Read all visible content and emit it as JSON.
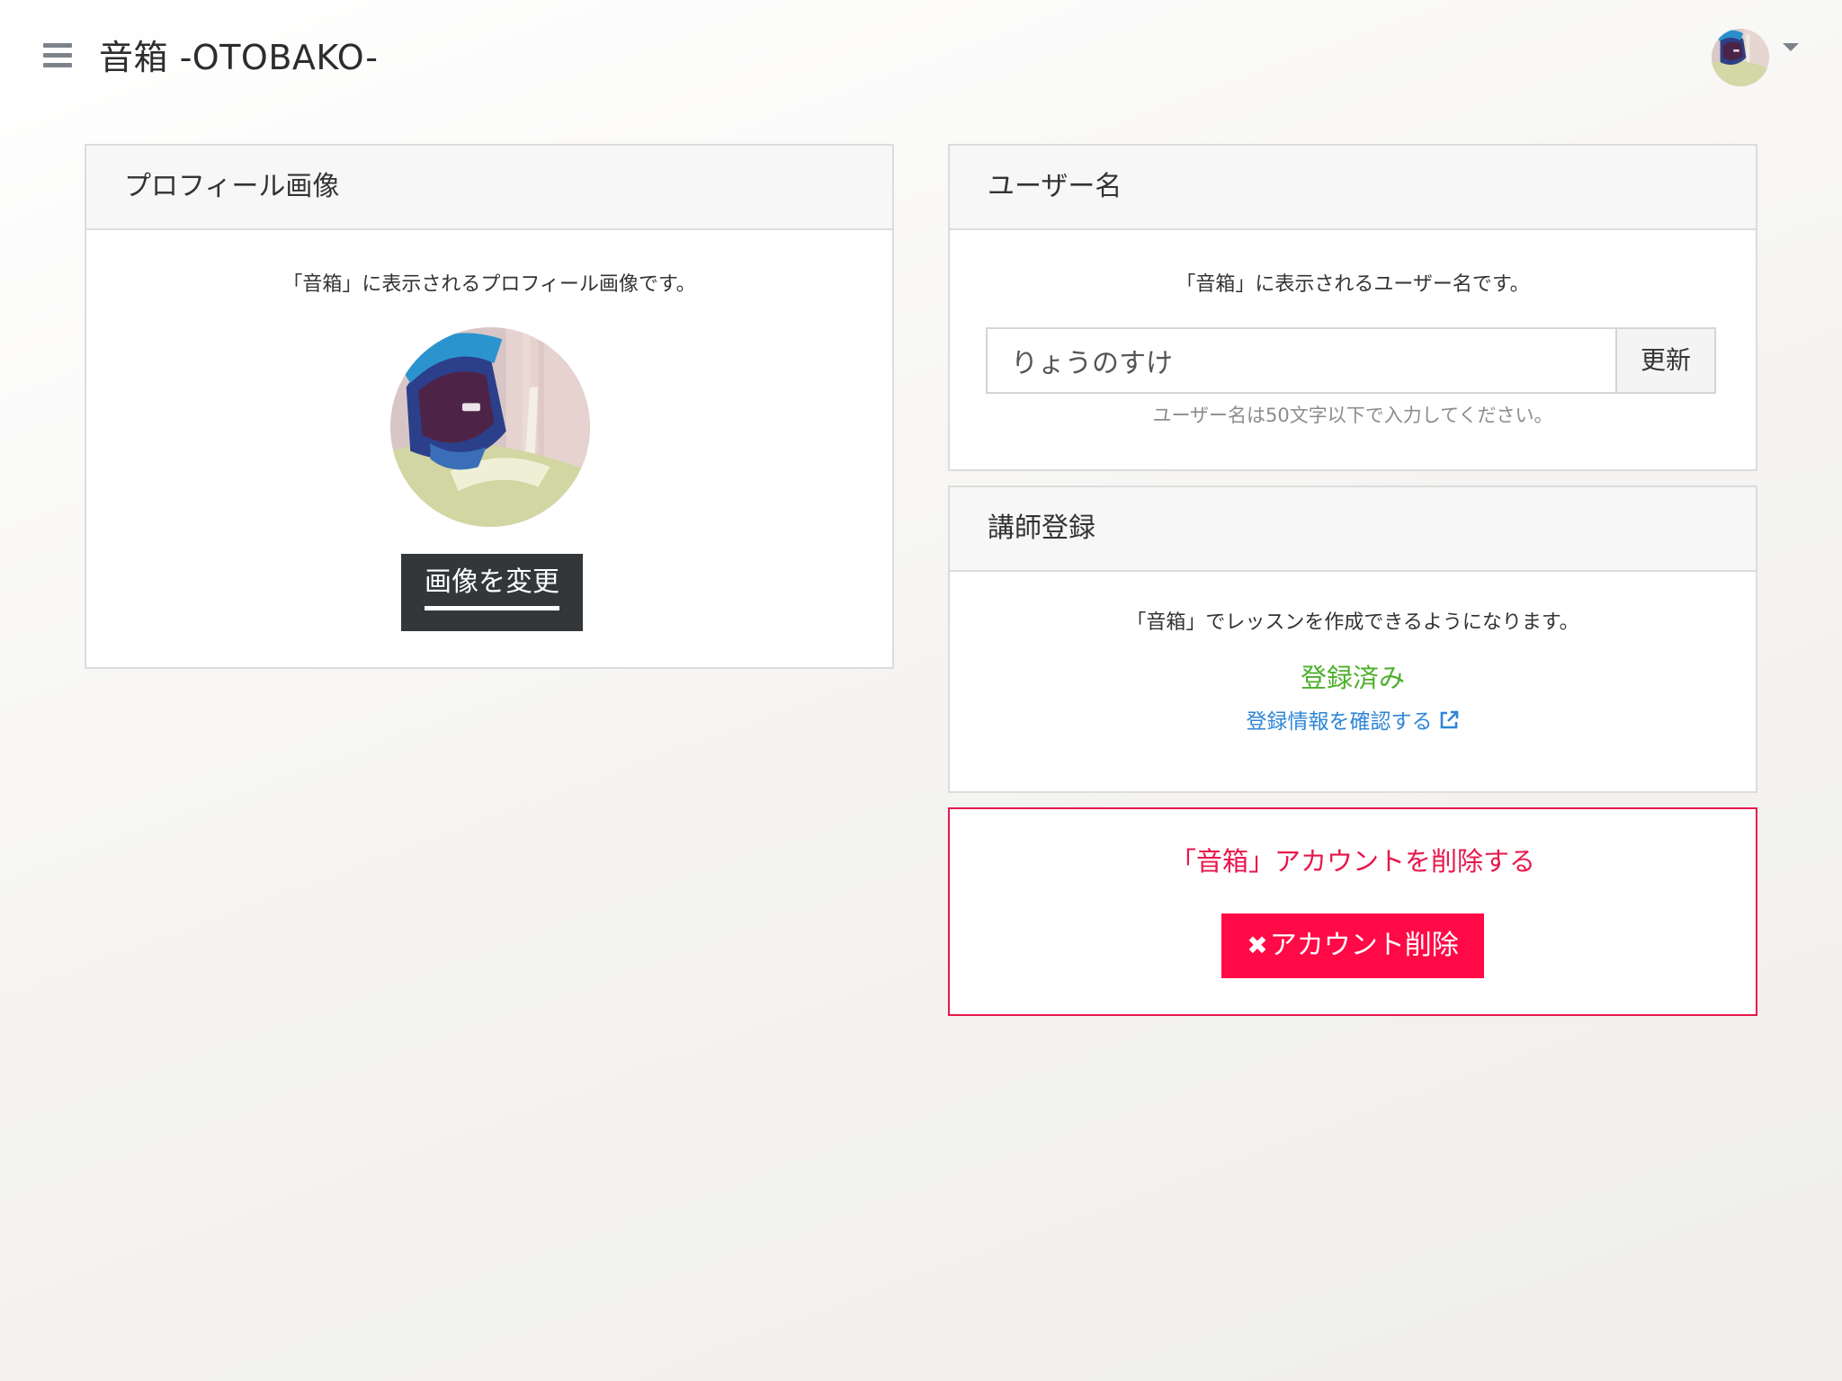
{
  "header": {
    "title": "音箱 -OTOBAKO-"
  },
  "profile_image": {
    "heading": "プロフィール画像",
    "description": "「音箱」に表示されるプロフィール画像です。",
    "change_button": "画像を変更"
  },
  "username": {
    "heading": "ユーザー名",
    "description": "「音箱」に表示されるユーザー名です。",
    "value": "りょうのすけ",
    "update_button": "更新",
    "hint": "ユーザー名は50文字以下で入力してください。"
  },
  "teacher": {
    "heading": "講師登録",
    "description": "「音箱」でレッスンを作成できるようになります。",
    "status": "登録済み",
    "link_label": "登録情報を確認する"
  },
  "delete_account": {
    "title": "「音箱」アカウントを削除する",
    "button_label": "アカウント削除"
  },
  "icons": {
    "menu": "menu-icon",
    "dropdown": "chevron-down-icon",
    "external": "external-link-icon",
    "delete": "close-icon"
  },
  "colors": {
    "danger": "#ff0a46",
    "success": "#4caf2a",
    "link": "#2f86d6",
    "dark_button": "#34373a"
  }
}
